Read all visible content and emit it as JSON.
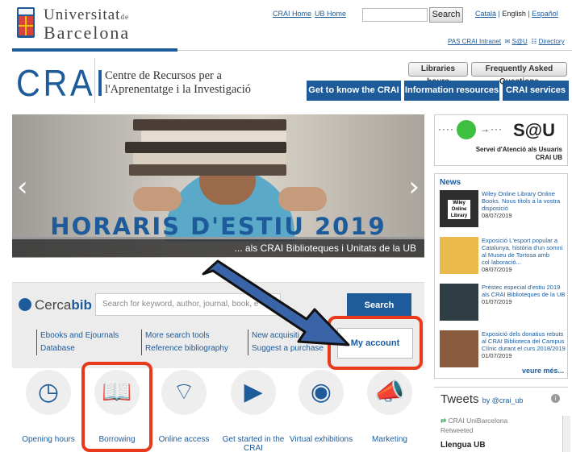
{
  "header": {
    "ub_name_line1": "Universitat",
    "ub_name_de": "de",
    "ub_name_line2": "Barcelona",
    "crai_home": "CRAI Home",
    "ub_home": "UB Home",
    "search_button": "Search",
    "lang_ca": "Català",
    "lang_en": "English",
    "lang_es": "Español",
    "pas_intranet": "PAS CRAI Intranet",
    "sau": "S@U",
    "directory": "Directory"
  },
  "crai": {
    "logo": "CRAI",
    "subtitle_line1": "Centre de Recursos per a",
    "subtitle_line2": "l'Aprenentatge i la Investigació",
    "libraries_hours": "Libraries hours",
    "faq": "Frequently Asked Questions",
    "nav": [
      "Get to know the CRAI",
      "Information resources",
      "CRAI services"
    ]
  },
  "slider": {
    "title": "HORARIS D'ESTIU 2019",
    "caption": "... als CRAI Biblioteques i Unitats de la UB"
  },
  "cercabib": {
    "logo_a": "Cerca",
    "logo_b": "bib",
    "placeholder": "Search for keyword, author, journal, book, e",
    "search": "Search",
    "col1": [
      "Ebooks and Ejournals",
      "Database"
    ],
    "col2": [
      "More search tools",
      "Reference bibliography"
    ],
    "col3": [
      "New acquisiti",
      "Suggest a purchase"
    ],
    "my_account": "My account"
  },
  "quicklinks": [
    {
      "label": "Opening hours",
      "icon": "clock-icon"
    },
    {
      "label": "Borrowing",
      "icon": "book-icon"
    },
    {
      "label": "Online access",
      "icon": "wifi-icon"
    },
    {
      "label": "Get started in the CRAI",
      "icon": "play-icon"
    },
    {
      "label": "Virtual exhibitions",
      "icon": "camera-icon"
    },
    {
      "label": "Marketing",
      "icon": "megaphone-icon"
    }
  ],
  "sau_box": {
    "title": "S@U",
    "line1": "Servei d'Atenció als Usuaris",
    "line2": "CRAI UB"
  },
  "news": {
    "heading": "News",
    "items": [
      {
        "text": "Wiley Online Library Online Books. Nous títols a la vostra disposició",
        "date": "08/07/2019"
      },
      {
        "text": "Exposició L'esport popular a Catalunya, història d'un somni al Museu de Tortosa amb col·laboració...",
        "date": "08/07/2019"
      },
      {
        "text": "Préstec especial d'estiu 2019 als CRAI Biblioteques de la UB",
        "date": "01/07/2019"
      },
      {
        "text": "Exposició dels donatius rebuts al CRAI Biblioteca del Campus Clínic durant el curs 2018/2019",
        "date": "01/07/2019"
      }
    ],
    "more": "veure més..."
  },
  "tweets": {
    "title": "Tweets",
    "by": "by @crai_ub",
    "retweeter": "CRAI UniBarcelona",
    "retweeted": "Retweeted",
    "author": "Llengua UB"
  },
  "colors": {
    "brand_blue": "#1d5b9b",
    "highlight_red": "#e8391c"
  }
}
